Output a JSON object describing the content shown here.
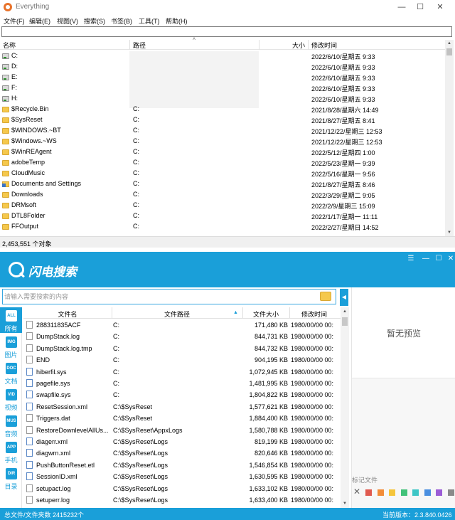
{
  "everything": {
    "title": "Everything",
    "menu": [
      "文件(F)",
      "编辑(E)",
      "视图(V)",
      "搜索(S)",
      "书签(B)",
      "工具(T)",
      "帮助(H)"
    ],
    "search_value": "",
    "columns": {
      "name": "名称",
      "path": "路径",
      "size": "大小",
      "modified": "修改时间"
    },
    "rows": [
      {
        "icon": "drive",
        "name": "C:",
        "path": "",
        "modified": "2022/6/10/星期五 9:33"
      },
      {
        "icon": "drive",
        "name": "D:",
        "path": "",
        "modified": "2022/6/10/星期五 9:33"
      },
      {
        "icon": "drive",
        "name": "E:",
        "path": "",
        "modified": "2022/6/10/星期五 9:33"
      },
      {
        "icon": "drive",
        "name": "F:",
        "path": "",
        "modified": "2022/6/10/星期五 9:33"
      },
      {
        "icon": "drive",
        "name": "H:",
        "path": "",
        "modified": "2022/6/10/星期五 9:33"
      },
      {
        "icon": "folder",
        "name": "$Recycle.Bin",
        "path": "C:",
        "modified": "2021/8/28/星期六 14:49"
      },
      {
        "icon": "folder",
        "name": "$SysReset",
        "path": "C:",
        "modified": "2021/8/27/星期五 8:41"
      },
      {
        "icon": "folder",
        "name": "$WINDOWS.~BT",
        "path": "C:",
        "modified": "2021/12/22/星期三 12:53"
      },
      {
        "icon": "folder",
        "name": "$Windows.~WS",
        "path": "C:",
        "modified": "2021/12/22/星期三 12:53"
      },
      {
        "icon": "folder",
        "name": "$WinREAgent",
        "path": "C:",
        "modified": "2022/5/12/星期四 1:00"
      },
      {
        "icon": "folder",
        "name": "adobeTemp",
        "path": "C:",
        "modified": "2022/5/23/星期一 9:39"
      },
      {
        "icon": "folder",
        "name": "CloudMusic",
        "path": "C:",
        "modified": "2022/5/16/星期一 9:56"
      },
      {
        "icon": "sysfolder",
        "name": "Documents and Settings",
        "path": "C:",
        "modified": "2021/8/27/星期五 8:46"
      },
      {
        "icon": "folder",
        "name": "Downloads",
        "path": "C:",
        "modified": "2022/3/29/星期二 9:05"
      },
      {
        "icon": "folder",
        "name": "DRMsoft",
        "path": "C:",
        "modified": "2022/2/9/星期三 15:09"
      },
      {
        "icon": "folder",
        "name": "DTL8Folder",
        "path": "C:",
        "modified": "2022/1/17/星期一 11:11"
      },
      {
        "icon": "folder",
        "name": "FFOutput",
        "path": "C:",
        "modified": "2022/2/27/星期日 14:52"
      }
    ],
    "status": "2,453,551 个对象"
  },
  "flash": {
    "title": "闪电搜索",
    "search_placeholder": "请输入需要搜索的内容",
    "categories": [
      {
        "key": "ALL",
        "label": "所有",
        "active": true
      },
      {
        "key": "IMG",
        "label": "图片",
        "active": false
      },
      {
        "key": "DOC",
        "label": "文档",
        "active": false
      },
      {
        "key": "VID",
        "label": "视频",
        "active": false
      },
      {
        "key": "MUS",
        "label": "音频",
        "active": false
      },
      {
        "key": "APP",
        "label": "手机",
        "active": false
      },
      {
        "key": "DIR",
        "label": "目录",
        "active": false
      }
    ],
    "columns": {
      "name": "文件名",
      "path": "文件路径",
      "size": "文件大小",
      "modified": "修改时间"
    },
    "rows": [
      {
        "name": "288311835ACF",
        "path": "C:",
        "size": "171,480 KB",
        "modified": "1980/00/00 00:"
      },
      {
        "name": "DumpStack.log",
        "path": "C:",
        "size": "844,731 KB",
        "modified": "1980/00/00 00:"
      },
      {
        "name": "DumpStack.log.tmp",
        "path": "C:",
        "size": "844,732 KB",
        "modified": "1980/00/00 00:"
      },
      {
        "name": "END",
        "path": "C:",
        "size": "904,195 KB",
        "modified": "1980/00/00 00:"
      },
      {
        "name": "hiberfil.sys",
        "path": "C:",
        "size": "1,072,945 KB",
        "modified": "1980/00/00 00:"
      },
      {
        "name": "pagefile.sys",
        "path": "C:",
        "size": "1,481,995 KB",
        "modified": "1980/00/00 00:"
      },
      {
        "name": "swapfile.sys",
        "path": "C:",
        "size": "1,804,822 KB",
        "modified": "1980/00/00 00:"
      },
      {
        "name": "ResetSession.xml",
        "path": "C:\\$SysReset",
        "size": "1,577,621 KB",
        "modified": "1980/00/00 00:"
      },
      {
        "name": "Triggers.dat",
        "path": "C:\\$SysReset",
        "size": "1,884,400 KB",
        "modified": "1980/00/00 00:"
      },
      {
        "name": "RestoreDownlevelAllUs...",
        "path": "C:\\$SysReset\\AppxLogs",
        "size": "1,580,788 KB",
        "modified": "1980/00/00 00:"
      },
      {
        "name": "diagerr.xml",
        "path": "C:\\$SysReset\\Logs",
        "size": "819,199 KB",
        "modified": "1980/00/00 00:"
      },
      {
        "name": "diagwrn.xml",
        "path": "C:\\$SysReset\\Logs",
        "size": "820,646 KB",
        "modified": "1980/00/00 00:"
      },
      {
        "name": "PushButtonReset.etl",
        "path": "C:\\$SysReset\\Logs",
        "size": "1,546,854 KB",
        "modified": "1980/00/00 00:"
      },
      {
        "name": "SessionID.xml",
        "path": "C:\\$SysReset\\Logs",
        "size": "1,630,595 KB",
        "modified": "1980/00/00 00:"
      },
      {
        "name": "setupact.log",
        "path": "C:\\$SysReset\\Logs",
        "size": "1,633,102 KB",
        "modified": "1980/00/00 00:"
      },
      {
        "name": "setuperr.log",
        "path": "C:\\$SysReset\\Logs",
        "size": "1,633,400 KB",
        "modified": "1980/00/00 00:"
      }
    ],
    "preview_empty": "暂无预览",
    "mark_label": "标记文件",
    "tag_colors": [
      "#e05a4f",
      "#f28c38",
      "#f5c53b",
      "#42c27a",
      "#3ec6c6",
      "#4a8fe0",
      "#9b5cd6",
      "#8a8a8a"
    ],
    "status_left": "总文件/文件夹数 2415232个",
    "status_right": "当前版本：2.3.840.0426"
  }
}
